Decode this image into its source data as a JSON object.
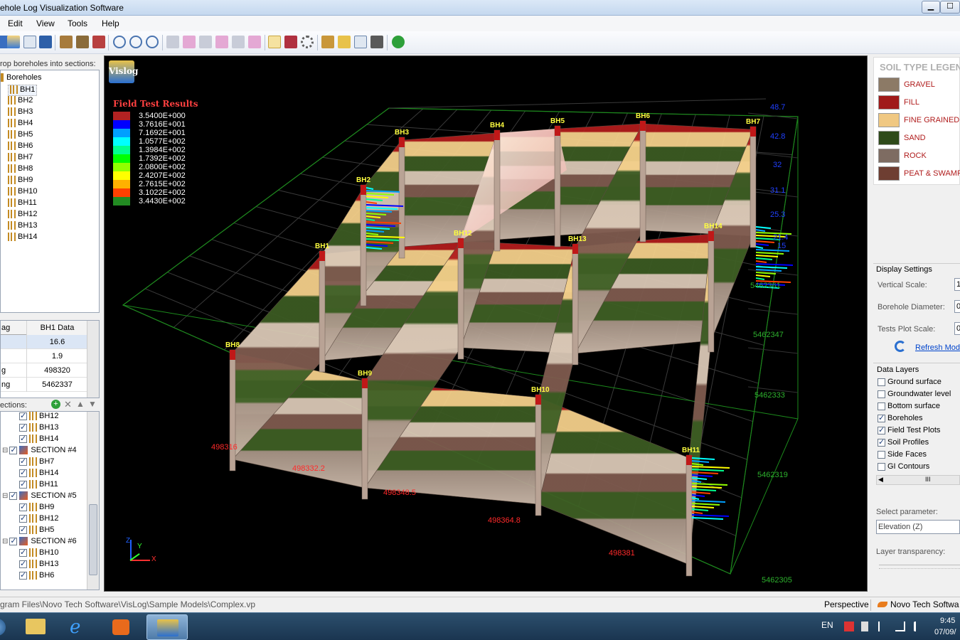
{
  "window": {
    "title": "ehole Log Visualization Software",
    "minimize": "▁",
    "maximize": "☐"
  },
  "menu": [
    "Edit",
    "View",
    "Tools",
    "Help"
  ],
  "left": {
    "tree_header": "rop boreholes into sections:",
    "tree_root": "Boreholes",
    "boreholes": [
      "BH1",
      "BH2",
      "BH3",
      "BH4",
      "BH5",
      "BH6",
      "BH7",
      "BH8",
      "BH9",
      "BH10",
      "BH11",
      "BH12",
      "BH13",
      "BH14"
    ],
    "grid_headers": [
      "ag",
      "BH1 Data"
    ],
    "grid_rows": [
      {
        "label": "",
        "value": "16.6"
      },
      {
        "label": "",
        "value": "1.9"
      },
      {
        "label": "g",
        "value": "498320"
      },
      {
        "label": "ng",
        "value": "5462337"
      }
    ],
    "sections_header": "ections:",
    "section_items": [
      {
        "kind": "bh",
        "label": "BH12"
      },
      {
        "kind": "bh",
        "label": "BH13"
      },
      {
        "kind": "bh",
        "label": "BH14"
      },
      {
        "kind": "sec",
        "label": "SECTION #4"
      },
      {
        "kind": "bh",
        "label": "BH7"
      },
      {
        "kind": "bh",
        "label": "BH14"
      },
      {
        "kind": "bh",
        "label": "BH11"
      },
      {
        "kind": "sec",
        "label": "SECTION #5"
      },
      {
        "kind": "bh",
        "label": "BH9"
      },
      {
        "kind": "bh",
        "label": "BH12"
      },
      {
        "kind": "bh",
        "label": "BH5"
      },
      {
        "kind": "sec",
        "label": "SECTION #6"
      },
      {
        "kind": "bh",
        "label": "BH10"
      },
      {
        "kind": "bh",
        "label": "BH13"
      },
      {
        "kind": "bh",
        "label": "BH6"
      }
    ]
  },
  "viewport": {
    "logo": "Vislog",
    "field_test_title": "Field Test Results",
    "color_scale": [
      {
        "value": "3.5400E+000",
        "color": "#b22222"
      },
      {
        "value": "3.7616E+001",
        "color": "#0000ff"
      },
      {
        "value": "7.1692E+001",
        "color": "#00a0ff"
      },
      {
        "value": "1.0577E+002",
        "color": "#00ffff"
      },
      {
        "value": "1.3984E+002",
        "color": "#00ff90"
      },
      {
        "value": "1.7392E+002",
        "color": "#00ff00"
      },
      {
        "value": "2.0800E+002",
        "color": "#90ff00"
      },
      {
        "value": "2.4207E+002",
        "color": "#ffff00"
      },
      {
        "value": "2.7615E+002",
        "color": "#ffb000"
      },
      {
        "value": "3.1022E+002",
        "color": "#ff4000"
      },
      {
        "value": "3.4430E+002",
        "color": "#228b22"
      }
    ],
    "bh_labels": [
      "BH1",
      "BH2",
      "BH3",
      "BH4",
      "BH5",
      "BH6",
      "BH7",
      "BH8",
      "BH9",
      "BH10",
      "BH11",
      "BH12",
      "BH13",
      "BH14"
    ],
    "z_labels": [
      "48.7",
      "42.8",
      "32",
      "31.1",
      "25.3",
      "21.4",
      "15"
    ],
    "north_labels": [
      "5462361",
      "5462347",
      "5462333",
      "5462319",
      "5462305"
    ],
    "east_labels": [
      "498316",
      "498332.2",
      "498348.5",
      "498364.8",
      "498381"
    ],
    "axis_letters": [
      "Z",
      "Y",
      "X"
    ]
  },
  "right": {
    "legend_title": "SOIL TYPE LEGEN",
    "soils": [
      {
        "name": "GRAVEL",
        "color": "#8c7a66"
      },
      {
        "name": "FILL",
        "color": "#a01a1a"
      },
      {
        "name": "FINE GRAINED",
        "color": "#f0c882"
      },
      {
        "name": "SAND",
        "color": "#2e4a1a"
      },
      {
        "name": "ROCK",
        "color": "#7e6c62"
      },
      {
        "name": "PEAT & SWAMP",
        "color": "#6e3e32"
      }
    ],
    "display_settings": "Display Settings",
    "vertical_scale": "Vertical Scale:",
    "vertical_scale_value": "1",
    "borehole_diameter": "Borehole Diameter:",
    "borehole_diameter_value": "0",
    "tests_plot_scale": "Tests Plot Scale:",
    "tests_plot_scale_value": "0",
    "refresh": "Refresh Mode",
    "data_layers": "Data Layers",
    "layers": [
      {
        "label": "Ground surface",
        "checked": false
      },
      {
        "label": "Groundwater level",
        "checked": false
      },
      {
        "label": "Bottom surface",
        "checked": false
      },
      {
        "label": "Boreholes",
        "checked": true
      },
      {
        "label": "Field Test Plots",
        "checked": true
      },
      {
        "label": "Soil Profiles",
        "checked": true
      },
      {
        "label": "Side Faces",
        "checked": false
      },
      {
        "label": "GI Contours",
        "checked": false
      }
    ],
    "select_parameter": "Select parameter:",
    "parameter_value": "Elevation (Z)",
    "layer_transparency": "Layer transparency:"
  },
  "status": {
    "path": "gram Files\\Novo Tech Software\\VisLog\\Sample Models\\Complex.vp",
    "mode": "Perspective",
    "company": "Novo Tech Softwa"
  },
  "taskbar": {
    "lang": "EN",
    "time": "9:45",
    "date": "07/09/"
  }
}
